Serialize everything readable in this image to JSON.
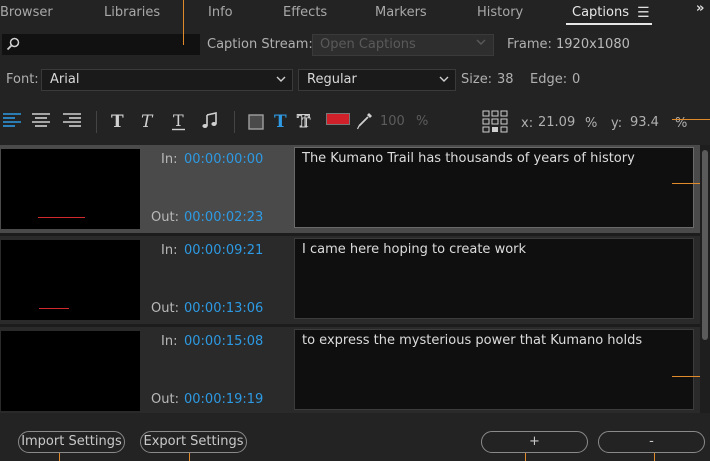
{
  "tabs": [
    {
      "label": "Browser"
    },
    {
      "label": "Libraries"
    },
    {
      "label": "Info"
    },
    {
      "label": "Effects"
    },
    {
      "label": "Markers"
    },
    {
      "label": "History"
    },
    {
      "label": "Captions",
      "active": true
    }
  ],
  "search": {
    "placeholder": ""
  },
  "caption_stream": {
    "label": "Caption Stream:",
    "value": "Open Captions"
  },
  "frame": {
    "label": "Frame:",
    "value": "1920x1080"
  },
  "font": {
    "label": "Font:",
    "family": "Arial",
    "style": "Regular"
  },
  "size": {
    "label": "Size:",
    "value": "38"
  },
  "edge": {
    "label": "Edge:",
    "value": "0"
  },
  "opacity": {
    "value": "100",
    "unit": "%"
  },
  "position": {
    "x_label": "x:",
    "x_value": "21.09",
    "x_unit": "%",
    "y_label": "y:",
    "y_value": "93.4",
    "y_unit": "%"
  },
  "colors": {
    "accent": "#2d9ae3",
    "text_color_swatch": "#d0202a",
    "annotation": "#e08a2a"
  },
  "captions": [
    {
      "in_label": "In:",
      "in": "00:00:00:00",
      "out_label": "Out:",
      "out": "00:00:02:23",
      "text": "The Kumano Trail has thousands of years of history",
      "selected": true
    },
    {
      "in_label": "In:",
      "in": "00:00:09:21",
      "out_label": "Out:",
      "out": "00:00:13:06",
      "text": "I came here hoping to create work",
      "selected": false
    },
    {
      "in_label": "In:",
      "in": "00:00:15:08",
      "out_label": "Out:",
      "out": "00:00:19:19",
      "text": "to express the mysterious power that Kumano holds",
      "selected": false
    }
  ],
  "footer": {
    "import_label": "Import Settings",
    "export_label": "Export Settings",
    "add_label": "+",
    "remove_label": "-"
  },
  "icons": [
    "search-icon",
    "chevron-down-icon",
    "align-left-icon",
    "align-center-icon",
    "align-right-icon",
    "bold-icon",
    "italic-icon",
    "underline-icon",
    "music-note-icon",
    "background-box-icon",
    "text-color-icon",
    "text-outline-icon",
    "eyedropper-icon",
    "position-grid-icon",
    "panel-menu-icon",
    "overflow-icon"
  ]
}
